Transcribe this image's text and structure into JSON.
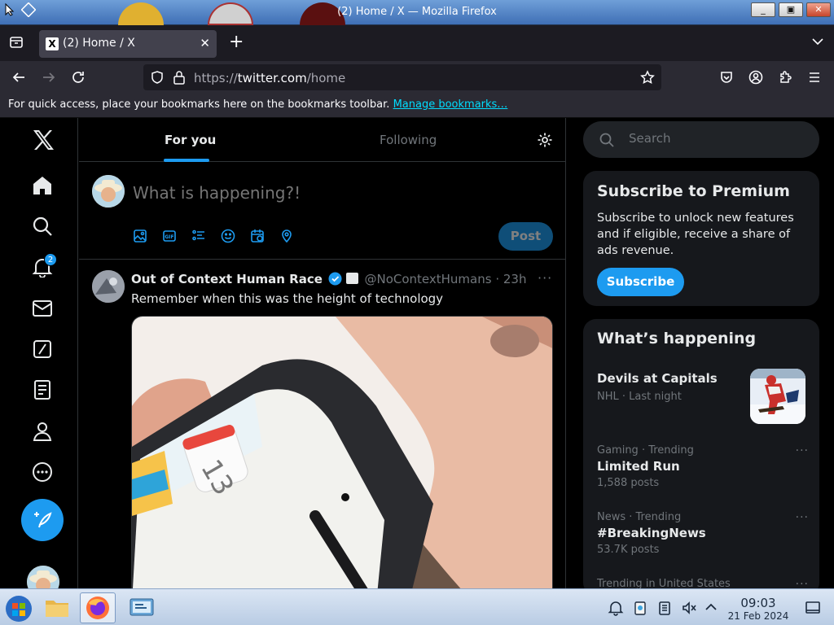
{
  "window": {
    "title": "(2) Home / X — Mozilla Firefox",
    "minimize_glyph": "_",
    "maximize_glyph": "▣",
    "close_glyph": "✕"
  },
  "browser": {
    "tab_title": "(2) Home / X",
    "tab_favicon": "X",
    "tab_close": "✕",
    "new_tab": "+",
    "url_scheme": "https://",
    "url_host": "twitter.com",
    "url_path": "/home",
    "bookmarks_hint": "For quick access, place your bookmarks here on the bookmarks toolbar.",
    "manage_bookmarks": "Manage bookmarks…"
  },
  "sidebar": {
    "notification_count": "2",
    "icons": [
      "x-logo-icon",
      "home-icon",
      "explore-icon",
      "notifications-icon",
      "messages-icon",
      "grok-icon",
      "lists-icon",
      "profile-icon",
      "more-icon",
      "compose-icon"
    ]
  },
  "feed": {
    "tabs": [
      {
        "label": "For you",
        "active": true
      },
      {
        "label": "Following",
        "active": false
      }
    ],
    "composer_placeholder": "What is happening?!",
    "post_button": "Post"
  },
  "tweet": {
    "author_name": "Out of Context Human Race",
    "handle": "@NoContextHumans",
    "separator": "·",
    "time": "23h",
    "text": "Remember when this was the height of technology",
    "more": "···",
    "media_calendar_day": "13"
  },
  "right": {
    "search_placeholder": "Search",
    "premium": {
      "heading": "Subscribe to Premium",
      "body": "Subscribe to unlock new features and if eligible, receive a share of ads revenue.",
      "button": "Subscribe"
    },
    "whats_happening": {
      "heading": "What’s happening",
      "trends": [
        {
          "name": "Devils at Capitals",
          "meta": "NHL · Last night",
          "count": ""
        },
        {
          "meta": "Gaming · Trending",
          "name": "Limited Run",
          "count": "1,588 posts"
        },
        {
          "meta": "News · Trending",
          "name": "#BreakingNews",
          "count": "53.7K posts"
        },
        {
          "meta": "Trending in United States",
          "name": "",
          "count": ""
        }
      ],
      "more": "···"
    }
  },
  "taskbar": {
    "time": "09:03",
    "date": "21 Feb 2024"
  },
  "colors": {
    "accent": "#1d9bf0",
    "background": "#000000",
    "border": "#2f3336",
    "muted_text": "#71767b",
    "primary_text": "#e7e9ea",
    "card": "#16181c"
  }
}
